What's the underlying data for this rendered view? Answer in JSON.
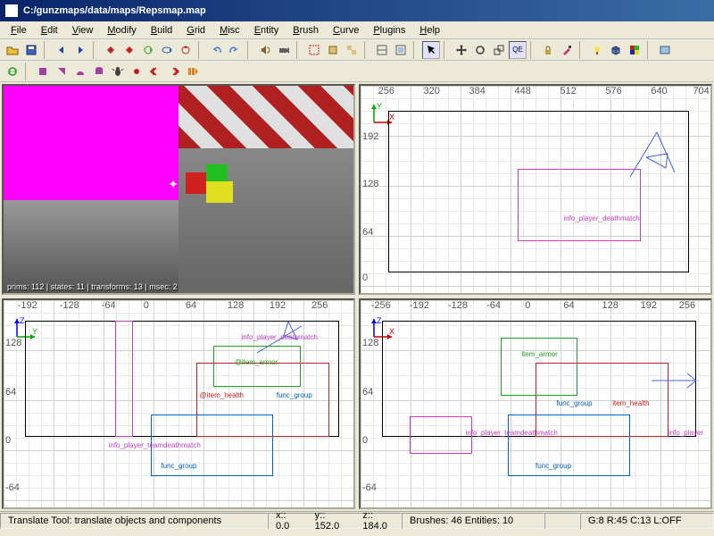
{
  "titlebar": {
    "path": "C:/gunzmaps/data/maps/Repsmap.map"
  },
  "menu": [
    "File",
    "Edit",
    "View",
    "Modify",
    "Build",
    "Grid",
    "Misc",
    "Entity",
    "Brush",
    "Curve",
    "Plugins",
    "Help"
  ],
  "toolbar2": {
    "items": [
      "file-open",
      "file-save",
      "sep",
      "tri-left",
      "tri-right",
      "sep",
      "edge-mode",
      "vertex-mode",
      "face-mode",
      "brush-mode",
      "entity-mode",
      "clip-mode",
      "sep",
      "undo",
      "redo",
      "sep",
      "sound",
      "camera",
      "sep",
      "region-set",
      "region-off",
      "sep",
      "tex-lock",
      "tex-fit",
      "sep",
      "select",
      "sep",
      "move",
      "rotate",
      "scale",
      "qe-toggle",
      "sep",
      "lock",
      "paint",
      "sep",
      "light",
      "cube",
      "color",
      "sep",
      "config"
    ]
  },
  "toolbar3": {
    "items": [
      "refresh",
      "patch1",
      "patch2",
      "patch3",
      "patch4",
      "bug",
      "dot",
      "prev-grid",
      "next-grid",
      "play"
    ]
  },
  "viewports": {
    "persp": {
      "stats": "prims: 112 | states: 11 | transforms: 13 | msec: 2"
    },
    "top": {
      "xticks": [
        256,
        320,
        384,
        448,
        512,
        576,
        640,
        704
      ],
      "yticks": [
        192,
        128,
        64,
        0
      ],
      "entities": [
        "info_player_deathmatch"
      ],
      "yaxis": "Y",
      "xaxis": "X"
    },
    "front": {
      "xticks": [
        -192,
        -128,
        -64,
        0,
        64,
        128,
        192,
        256
      ],
      "yticks": [
        128,
        64,
        0,
        -64
      ],
      "yaxis": "Z",
      "xaxis": "Y",
      "entities": [
        "info_player_deathmatch",
        "@item_armor",
        "@item_health",
        "func_group",
        "info_player_teamdeathmatch",
        "func_group"
      ]
    },
    "side": {
      "xticks": [
        -256,
        -192,
        -128,
        -64,
        0,
        64,
        128,
        192,
        256
      ],
      "yticks": [
        128,
        64,
        0,
        -64
      ],
      "yaxis": "Z",
      "xaxis": "X",
      "entities": [
        "item_armor",
        "func_group",
        "item_health",
        "info_player_teamdeathmatch",
        "func_group",
        "info_player"
      ]
    }
  },
  "status": {
    "tool": "Translate Tool: translate objects and components",
    "coords_x": "x:: 0.0",
    "coords_y": "y:: 152.0",
    "coords_z": "z:: 184.0",
    "brushes": "Brushes: 46 Entities: 10",
    "grid": "G:8  R:45  C:13  L:OFF"
  }
}
